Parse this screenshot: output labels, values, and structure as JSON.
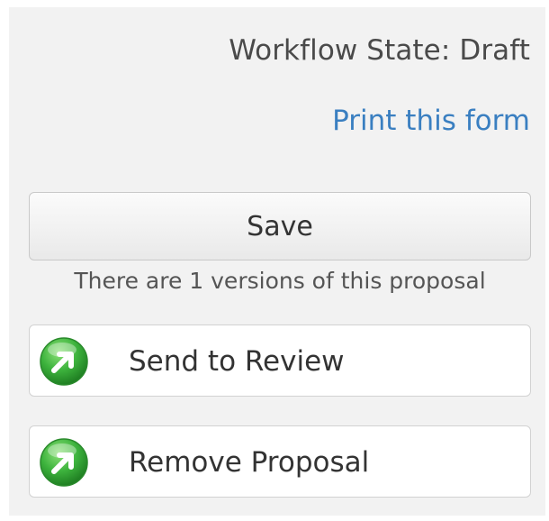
{
  "workflow": {
    "state_text": "Workflow State: Draft"
  },
  "links": {
    "print_label": "Print this form"
  },
  "buttons": {
    "save_label": "Save",
    "send_to_review_label": "Send to Review",
    "remove_proposal_label": "Remove Proposal"
  },
  "versions": {
    "note": "There are 1 versions of this proposal"
  },
  "icons": {
    "action": "green-arrow-up-right-icon"
  },
  "colors": {
    "link": "#3a7fc1",
    "icon_green": "#3db33d",
    "panel_background": "#f2f2f2"
  }
}
